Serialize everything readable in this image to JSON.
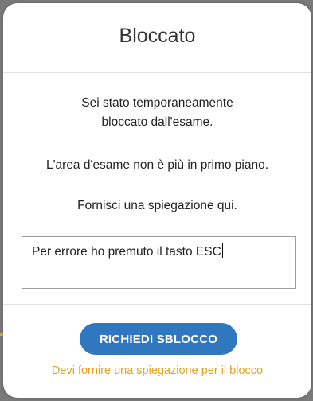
{
  "dialog": {
    "title": "Bloccato",
    "message_locked": "Sei stato temporaneamente bloccato dall'esame.",
    "message_focus": "L'area d'esame non è più in primo piano.",
    "message_explain": "Fornisci una spiegazione qui.",
    "explanation_value": "Per errore ho premuto il tasto ESC",
    "unlock_button_label": "RICHIEDI SBLOCCO",
    "warning_text": "Devi fornire una spiegazione per il blocco"
  },
  "colors": {
    "button": "#2f78bf",
    "warning": "#e4a21f",
    "overlay": "#7a7a7a"
  }
}
